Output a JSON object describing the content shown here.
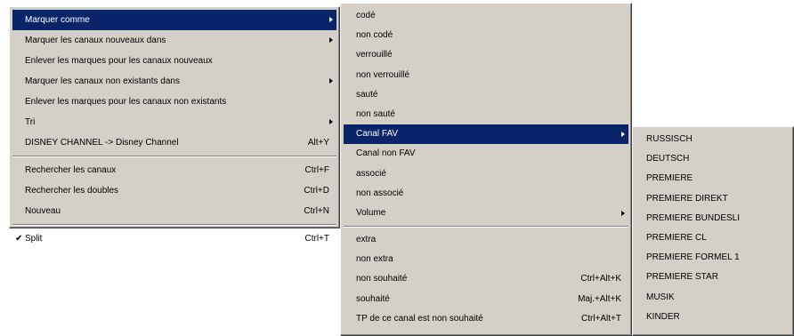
{
  "main_menu": {
    "items": [
      {
        "label": "Marquer comme",
        "shortcut": "",
        "submenu": true,
        "highlighted": true
      },
      {
        "label": "Marquer les canaux nouveaux dans",
        "shortcut": "",
        "submenu": true
      },
      {
        "label": "Enlever les marques pour les canaux nouveaux",
        "shortcut": "",
        "submenu": false
      },
      {
        "label": "Marquer les canaux non existants dans",
        "shortcut": "",
        "submenu": true
      },
      {
        "label": "Enlever les marques pour les canaux non existants",
        "shortcut": "",
        "submenu": false
      },
      {
        "label": "Tri",
        "shortcut": "",
        "submenu": true
      },
      {
        "label": "DISNEY CHANNEL -> Disney Channel",
        "shortcut": "Alt+Y",
        "submenu": false
      },
      {
        "label": "Rechercher les canaux",
        "shortcut": "Ctrl+F",
        "submenu": false
      },
      {
        "label": "Rechercher les doubles",
        "shortcut": "Ctrl+D",
        "submenu": false
      },
      {
        "label": "Nouveau",
        "shortcut": "Ctrl+N",
        "submenu": false
      },
      {
        "label": "Split",
        "shortcut": "Ctrl+T",
        "submenu": false,
        "checked": true
      }
    ],
    "check_mark": "✔"
  },
  "marquer_comme_menu": {
    "items": [
      {
        "label": "codé",
        "shortcut": ""
      },
      {
        "label": "non codé",
        "shortcut": ""
      },
      {
        "label": "verrouillé",
        "shortcut": ""
      },
      {
        "label": "non verrouillé",
        "shortcut": ""
      },
      {
        "label": "sauté",
        "shortcut": ""
      },
      {
        "label": "non sauté",
        "shortcut": ""
      },
      {
        "label": "Canal FAV",
        "shortcut": "",
        "submenu": true,
        "highlighted": true
      },
      {
        "label": "Canal non FAV",
        "shortcut": ""
      },
      {
        "label": "associé",
        "shortcut": ""
      },
      {
        "label": "non associé",
        "shortcut": ""
      },
      {
        "label": "Volume",
        "shortcut": "",
        "submenu": true
      },
      {
        "label": "extra",
        "shortcut": ""
      },
      {
        "label": "non extra",
        "shortcut": ""
      },
      {
        "label": "non souhaité",
        "shortcut": "Ctrl+Alt+K"
      },
      {
        "label": "souhaité",
        "shortcut": "Maj.+Alt+K"
      },
      {
        "label": "TP de ce canal est non souhaité",
        "shortcut": "Ctrl+Alt+T"
      }
    ]
  },
  "canal_fav_menu": {
    "items": [
      "RUSSISCH",
      "DEUTSCH",
      "PREMIERE",
      "PREMIERE DIREKT",
      "PREMIERE BUNDESLI",
      "PREMIERE CL",
      "PREMIERE FORMEL 1",
      "PREMIERE STAR",
      "MUSIK",
      "KINDER"
    ]
  }
}
